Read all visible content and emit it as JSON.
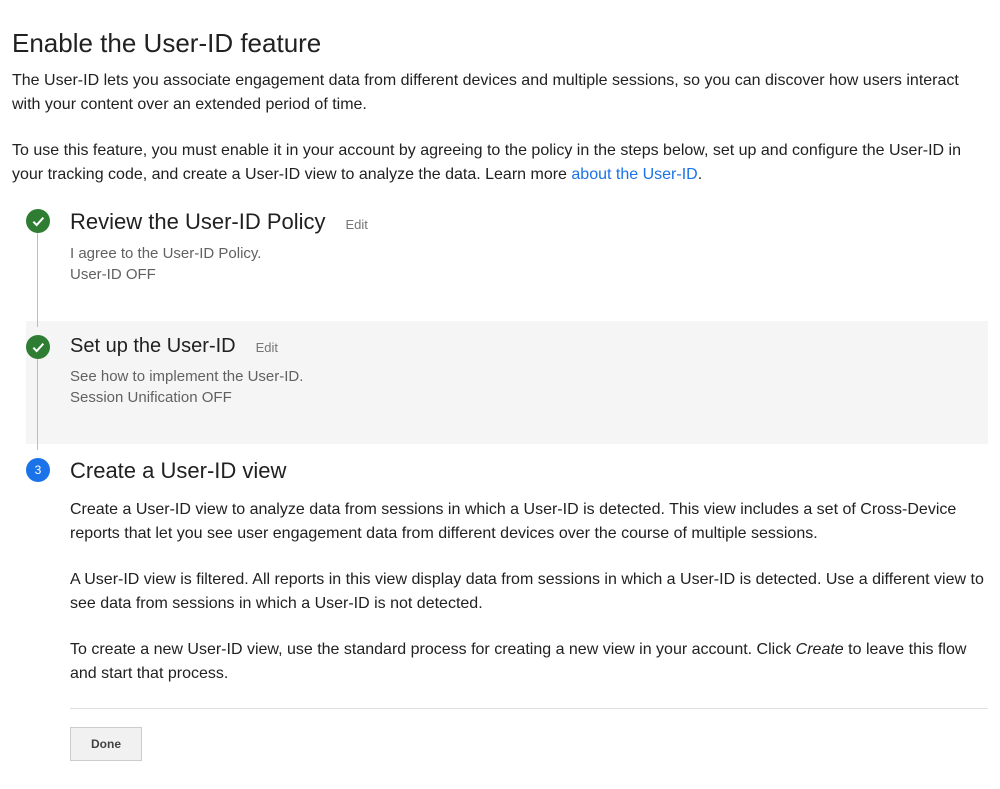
{
  "page": {
    "title": "Enable the User-ID feature",
    "intro1": "The User-ID lets you associate engagement data from different devices and multiple sessions, so you can discover how users interact with your content over an extended period of time.",
    "intro2_prefix": "To use this feature, you must enable it in your account by agreeing to the policy in the steps below, set up and configure the User-ID in your tracking code, and create a User-ID view to analyze the data. Learn more ",
    "intro2_link": "about the User-ID",
    "intro2_suffix": "."
  },
  "steps": {
    "step1": {
      "title": "Review the User-ID Policy",
      "edit": "Edit",
      "line1": "I agree to the User-ID Policy.",
      "line2": "User-ID OFF"
    },
    "step2": {
      "title": "Set up the User-ID",
      "edit": "Edit",
      "line1": "See how to implement the User-ID.",
      "line2": "Session Unification OFF"
    },
    "step3": {
      "number": "3",
      "title": "Create a User-ID view",
      "para1": "Create a User-ID view to analyze data from sessions in which a User-ID is detected. This view includes a set of Cross-Device reports that let you see user engagement data from different devices over the course of multiple sessions.",
      "para2": "A User-ID view is filtered. All reports in this view display data from sessions in which a User-ID is detected. Use a different view to see data from sessions in which a User-ID is not detected.",
      "para3_prefix": "To create a new User-ID view, use the standard process for creating a new view in your account. Click ",
      "para3_italic": "Create",
      "para3_suffix": " to leave this flow and start that process.",
      "done": "Done"
    }
  }
}
